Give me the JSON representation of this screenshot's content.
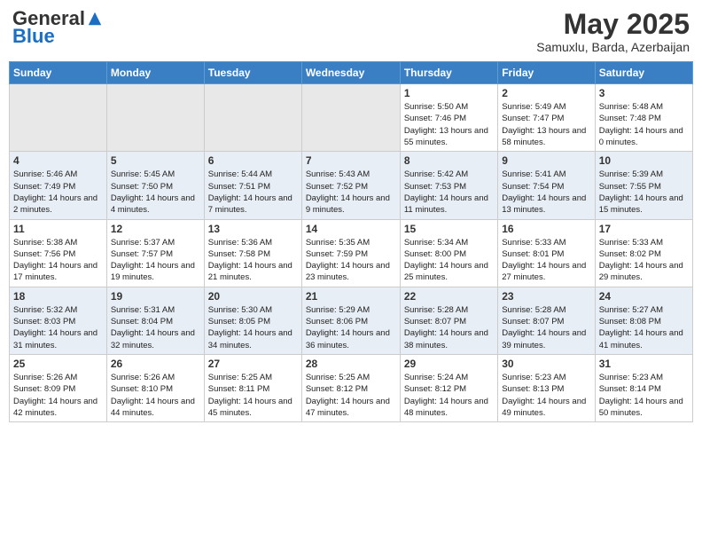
{
  "logo": {
    "general": "General",
    "blue": "Blue"
  },
  "title": {
    "month_year": "May 2025",
    "location": "Samuxlu, Barda, Azerbaijan"
  },
  "days_of_week": [
    "Sunday",
    "Monday",
    "Tuesday",
    "Wednesday",
    "Thursday",
    "Friday",
    "Saturday"
  ],
  "weeks": [
    [
      {
        "day": "",
        "empty": true
      },
      {
        "day": "",
        "empty": true
      },
      {
        "day": "",
        "empty": true
      },
      {
        "day": "",
        "empty": true
      },
      {
        "day": "1",
        "sunrise": "Sunrise: 5:50 AM",
        "sunset": "Sunset: 7:46 PM",
        "daylight": "Daylight: 13 hours and 55 minutes."
      },
      {
        "day": "2",
        "sunrise": "Sunrise: 5:49 AM",
        "sunset": "Sunset: 7:47 PM",
        "daylight": "Daylight: 13 hours and 58 minutes."
      },
      {
        "day": "3",
        "sunrise": "Sunrise: 5:48 AM",
        "sunset": "Sunset: 7:48 PM",
        "daylight": "Daylight: 14 hours and 0 minutes."
      }
    ],
    [
      {
        "day": "4",
        "sunrise": "Sunrise: 5:46 AM",
        "sunset": "Sunset: 7:49 PM",
        "daylight": "Daylight: 14 hours and 2 minutes."
      },
      {
        "day": "5",
        "sunrise": "Sunrise: 5:45 AM",
        "sunset": "Sunset: 7:50 PM",
        "daylight": "Daylight: 14 hours and 4 minutes."
      },
      {
        "day": "6",
        "sunrise": "Sunrise: 5:44 AM",
        "sunset": "Sunset: 7:51 PM",
        "daylight": "Daylight: 14 hours and 7 minutes."
      },
      {
        "day": "7",
        "sunrise": "Sunrise: 5:43 AM",
        "sunset": "Sunset: 7:52 PM",
        "daylight": "Daylight: 14 hours and 9 minutes."
      },
      {
        "day": "8",
        "sunrise": "Sunrise: 5:42 AM",
        "sunset": "Sunset: 7:53 PM",
        "daylight": "Daylight: 14 hours and 11 minutes."
      },
      {
        "day": "9",
        "sunrise": "Sunrise: 5:41 AM",
        "sunset": "Sunset: 7:54 PM",
        "daylight": "Daylight: 14 hours and 13 minutes."
      },
      {
        "day": "10",
        "sunrise": "Sunrise: 5:39 AM",
        "sunset": "Sunset: 7:55 PM",
        "daylight": "Daylight: 14 hours and 15 minutes."
      }
    ],
    [
      {
        "day": "11",
        "sunrise": "Sunrise: 5:38 AM",
        "sunset": "Sunset: 7:56 PM",
        "daylight": "Daylight: 14 hours and 17 minutes."
      },
      {
        "day": "12",
        "sunrise": "Sunrise: 5:37 AM",
        "sunset": "Sunset: 7:57 PM",
        "daylight": "Daylight: 14 hours and 19 minutes."
      },
      {
        "day": "13",
        "sunrise": "Sunrise: 5:36 AM",
        "sunset": "Sunset: 7:58 PM",
        "daylight": "Daylight: 14 hours and 21 minutes."
      },
      {
        "day": "14",
        "sunrise": "Sunrise: 5:35 AM",
        "sunset": "Sunset: 7:59 PM",
        "daylight": "Daylight: 14 hours and 23 minutes."
      },
      {
        "day": "15",
        "sunrise": "Sunrise: 5:34 AM",
        "sunset": "Sunset: 8:00 PM",
        "daylight": "Daylight: 14 hours and 25 minutes."
      },
      {
        "day": "16",
        "sunrise": "Sunrise: 5:33 AM",
        "sunset": "Sunset: 8:01 PM",
        "daylight": "Daylight: 14 hours and 27 minutes."
      },
      {
        "day": "17",
        "sunrise": "Sunrise: 5:33 AM",
        "sunset": "Sunset: 8:02 PM",
        "daylight": "Daylight: 14 hours and 29 minutes."
      }
    ],
    [
      {
        "day": "18",
        "sunrise": "Sunrise: 5:32 AM",
        "sunset": "Sunset: 8:03 PM",
        "daylight": "Daylight: 14 hours and 31 minutes."
      },
      {
        "day": "19",
        "sunrise": "Sunrise: 5:31 AM",
        "sunset": "Sunset: 8:04 PM",
        "daylight": "Daylight: 14 hours and 32 minutes."
      },
      {
        "day": "20",
        "sunrise": "Sunrise: 5:30 AM",
        "sunset": "Sunset: 8:05 PM",
        "daylight": "Daylight: 14 hours and 34 minutes."
      },
      {
        "day": "21",
        "sunrise": "Sunrise: 5:29 AM",
        "sunset": "Sunset: 8:06 PM",
        "daylight": "Daylight: 14 hours and 36 minutes."
      },
      {
        "day": "22",
        "sunrise": "Sunrise: 5:28 AM",
        "sunset": "Sunset: 8:07 PM",
        "daylight": "Daylight: 14 hours and 38 minutes."
      },
      {
        "day": "23",
        "sunrise": "Sunrise: 5:28 AM",
        "sunset": "Sunset: 8:07 PM",
        "daylight": "Daylight: 14 hours and 39 minutes."
      },
      {
        "day": "24",
        "sunrise": "Sunrise: 5:27 AM",
        "sunset": "Sunset: 8:08 PM",
        "daylight": "Daylight: 14 hours and 41 minutes."
      }
    ],
    [
      {
        "day": "25",
        "sunrise": "Sunrise: 5:26 AM",
        "sunset": "Sunset: 8:09 PM",
        "daylight": "Daylight: 14 hours and 42 minutes."
      },
      {
        "day": "26",
        "sunrise": "Sunrise: 5:26 AM",
        "sunset": "Sunset: 8:10 PM",
        "daylight": "Daylight: 14 hours and 44 minutes."
      },
      {
        "day": "27",
        "sunrise": "Sunrise: 5:25 AM",
        "sunset": "Sunset: 8:11 PM",
        "daylight": "Daylight: 14 hours and 45 minutes."
      },
      {
        "day": "28",
        "sunrise": "Sunrise: 5:25 AM",
        "sunset": "Sunset: 8:12 PM",
        "daylight": "Daylight: 14 hours and 47 minutes."
      },
      {
        "day": "29",
        "sunrise": "Sunrise: 5:24 AM",
        "sunset": "Sunset: 8:12 PM",
        "daylight": "Daylight: 14 hours and 48 minutes."
      },
      {
        "day": "30",
        "sunrise": "Sunrise: 5:23 AM",
        "sunset": "Sunset: 8:13 PM",
        "daylight": "Daylight: 14 hours and 49 minutes."
      },
      {
        "day": "31",
        "sunrise": "Sunrise: 5:23 AM",
        "sunset": "Sunset: 8:14 PM",
        "daylight": "Daylight: 14 hours and 50 minutes."
      }
    ]
  ]
}
